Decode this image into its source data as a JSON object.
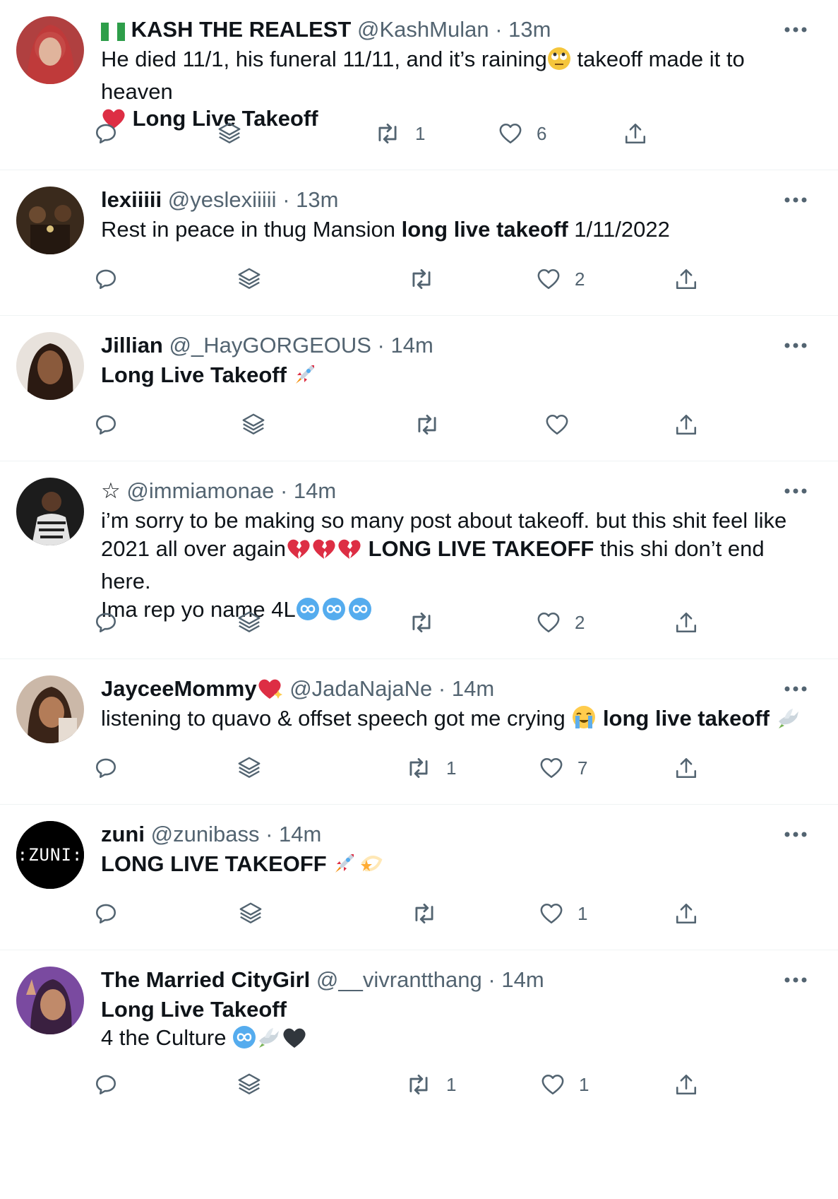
{
  "tweets": [
    {
      "flag": "nigeria-flag",
      "name": "KASH THE REALEST",
      "handle": "@KashMulan",
      "time": "13m",
      "line1_a": "He died 11/1, his funeral 11/11, and it’s raining",
      "line1_emoji": "face-with-rolling-eyes",
      "line1_b": " takeoff made it to heaven",
      "line2_emoji": "red-heart",
      "line2_bold": "Long Live Takeoff",
      "retweets": "1",
      "likes": "6"
    },
    {
      "name": "lexiiiii",
      "handle": "@yeslexiiiii",
      "time": "13m",
      "text_a": "Rest in peace in thug Mansion ",
      "text_bold": "long live takeoff",
      "text_b": " 1/11/2022",
      "retweets": "",
      "likes": "2"
    },
    {
      "name": "Jillian",
      "handle": "@_HayGORGEOUS",
      "time": "14m",
      "text_bold": "Long Live Takeoff",
      "emoji": "rocket",
      "retweets": "",
      "likes": ""
    },
    {
      "name": "☆",
      "handle": "@immiamonae",
      "time": "14m",
      "line1": "i’m sorry to be making so many post about takeoff. but this shit feel like",
      "line2_a": "2021 all over again",
      "line2_emoji": "broken-heart x3",
      "line2_bold": " LONG LIVE TAKEOFF",
      "line2_b": " this shi don’t end here.",
      "line3": "Ima rep yo name 4L",
      "line3_emoji": "infinity x3",
      "retweets": "",
      "likes": "2"
    },
    {
      "name": "JayceeMommy",
      "name_emoji": "heart-with-sparkles",
      "handle": "@JadaNajaNe",
      "time": "14m",
      "text_a": "listening to quavo & offset speech got me crying ",
      "emoji1": "loudly-crying-face",
      "text_bold": " long live takeoff",
      "emoji2": "dove",
      "retweets": "1",
      "likes": "7"
    },
    {
      "name": "zuni",
      "handle": "@zunibass",
      "time": "14m",
      "avatar_text": ":ZUNI:",
      "text_bold": "LONG LIVE TAKEOFF",
      "emoji": "rocket, dizzy-star",
      "retweets": "",
      "likes": "1"
    },
    {
      "name": "The Married CityGirl",
      "handle": "@__vivrantthang",
      "time": "14m",
      "line1_bold": "Long Live Takeoff",
      "line2": "4 the Culture ",
      "line2_emoji": "infinity, dove, black-heart",
      "retweets": "1",
      "likes": "1"
    }
  ],
  "separator": "·",
  "colors": {
    "text": "#0f1419",
    "muted": "#536471",
    "divider": "#eff3f4"
  }
}
